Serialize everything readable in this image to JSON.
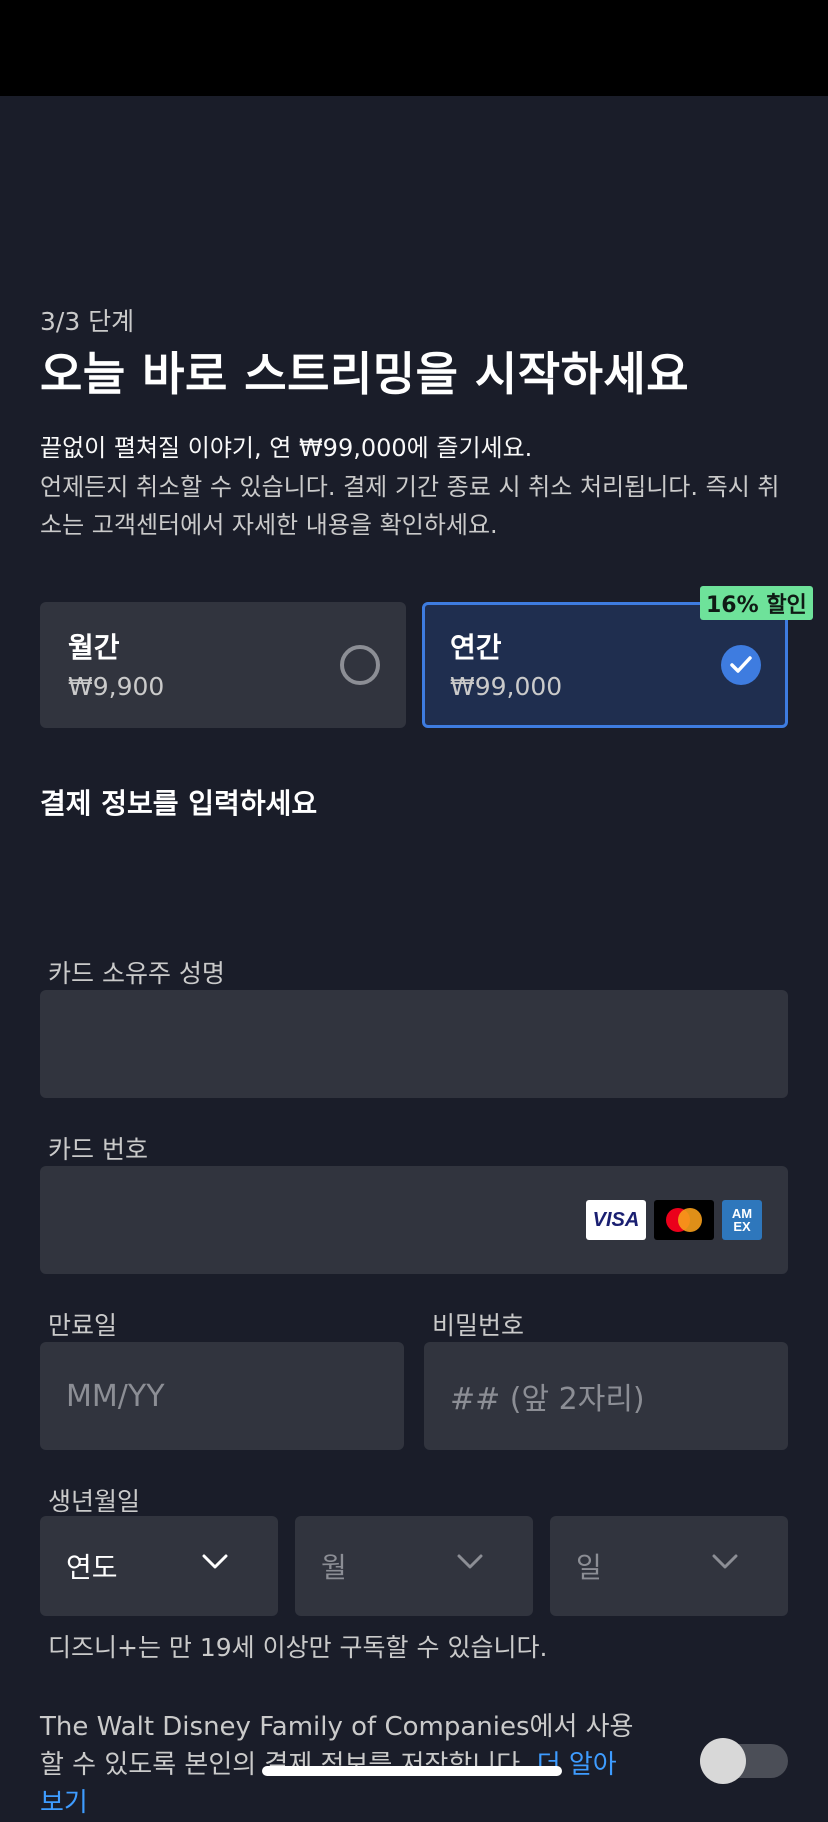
{
  "header": {
    "step": "3/3 단계",
    "title": "오늘 바로 스트리밍을 시작하세요",
    "desc_line1": "끝없이 펼쳐질 이야기, 연 ₩99,000에 즐기세요.",
    "desc_line2": "언제든지 취소할 수 있습니다. 결제 기간 종료 시 취소 처리됩니다. 즉시 취소는 고객센터에서 자세한 내용을 확인하세요."
  },
  "plans": [
    {
      "name": "월간",
      "price": "₩9,900",
      "selected": false
    },
    {
      "name": "연간",
      "price": "₩99,000",
      "selected": true
    }
  ],
  "discount_badge": "16% 할인",
  "payment": {
    "section_title": "결제 정보를 입력하세요",
    "cardholder_label": "카드 소유주 성명",
    "card_number_label": "카드 번호",
    "card_brands": [
      "VISA",
      "mastercard",
      "AMEX"
    ],
    "expiry_label": "만료일",
    "expiry_placeholder": "MM/YY",
    "password_label": "비밀번호",
    "password_placeholder": "## (앞 2자리)",
    "birth_label": "생년월일",
    "birth_year": "연도",
    "birth_month": "월",
    "birth_day": "일",
    "age_note": "디즈니+는 만 19세 이상만 구독할 수 있습니다.",
    "save_text": "The Walt Disney Family of Companies에서 사용할 수 있도록 본인의 결제 정보를 저장합니다.",
    "learn_more": "더 알아보기",
    "save_toggle_on": false
  },
  "colors": {
    "background": "#1a1d29",
    "field": "#31343e",
    "accent": "#3e7ce0",
    "badge": "#6ee29a"
  }
}
